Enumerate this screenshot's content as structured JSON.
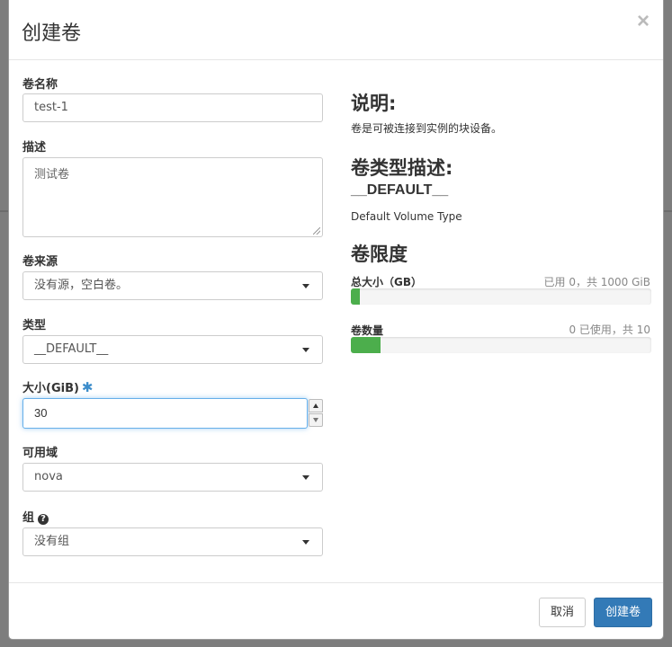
{
  "dialog": {
    "title": "创建卷",
    "close_glyph": "×"
  },
  "form": {
    "name": {
      "label": "卷名称",
      "value": "test-1"
    },
    "description": {
      "label": "描述",
      "value": "测试卷"
    },
    "source": {
      "label": "卷来源",
      "value": "没有源，空白卷。"
    },
    "type": {
      "label": "类型",
      "value": "__DEFAULT__"
    },
    "size": {
      "label": "大小(GiB)",
      "required_mark": "✱",
      "value": "30"
    },
    "availability_zone": {
      "label": "可用域",
      "value": "nova"
    },
    "group": {
      "label": "组",
      "help_glyph": "?",
      "value": "没有组"
    }
  },
  "info": {
    "description_heading": "说明:",
    "description_text": "卷是可被连接到实例的块设备。",
    "type_heading": "卷类型描述:",
    "type_name": "__DEFAULT__",
    "type_text": "Default Volume Type",
    "limits_heading": "卷限度",
    "quotas": [
      {
        "label": "总大小（GB）",
        "detail": "已用 0，共 1000 GiB",
        "fill_percent": 3
      },
      {
        "label": "卷数量",
        "detail": "0 已使用，共 10",
        "fill_percent": 10
      }
    ]
  },
  "footer": {
    "cancel_label": "取消",
    "submit_label": "创建卷"
  },
  "colors": {
    "primary": "#337ab7",
    "progress": "#4cae4c",
    "required": "#3c8dcb"
  }
}
